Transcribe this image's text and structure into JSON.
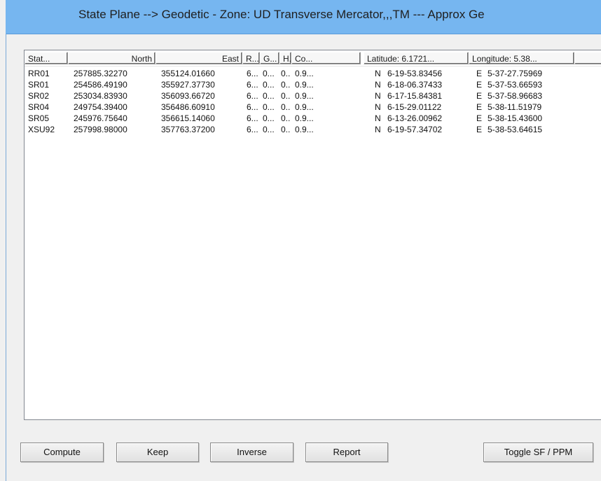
{
  "window": {
    "title": "State Plane --> Geodetic - Zone: UD Transverse Mercator,,,TM --- Approx Ge"
  },
  "columns": [
    {
      "label": "Stat..."
    },
    {
      "label": "North"
    },
    {
      "label": "East"
    },
    {
      "label": "R..."
    },
    {
      "label": "G..."
    },
    {
      "label": "H."
    },
    {
      "label": "Co..."
    },
    {
      "label": "Latitude: 6.1721..."
    },
    {
      "label": "Longitude: 5.38..."
    }
  ],
  "rows": [
    {
      "station": "RR01",
      "north": "257885.32270",
      "east": "355124.01660",
      "r": "6...",
      "g": "0...",
      "h": "0..",
      "co": "0.9...",
      "lat_hem": "N",
      "lat": "6-19-53.83456",
      "lon_hem": "E",
      "lon": "5-37-27.75969"
    },
    {
      "station": "SR01",
      "north": "254586.49190",
      "east": "355927.37730",
      "r": "6...",
      "g": "0...",
      "h": "0..",
      "co": "0.9...",
      "lat_hem": "N",
      "lat": "6-18-06.37433",
      "lon_hem": "E",
      "lon": "5-37-53.66593"
    },
    {
      "station": "SR02",
      "north": "253034.83930",
      "east": "356093.66720",
      "r": "6...",
      "g": "0...",
      "h": "0..",
      "co": "0.9...",
      "lat_hem": "N",
      "lat": "6-17-15.84381",
      "lon_hem": "E",
      "lon": "5-37-58.96683"
    },
    {
      "station": "SR04",
      "north": "249754.39400",
      "east": "356486.60910",
      "r": "6...",
      "g": "0...",
      "h": "0..",
      "co": "0.9...",
      "lat_hem": "N",
      "lat": "6-15-29.01122",
      "lon_hem": "E",
      "lon": "5-38-11.51979"
    },
    {
      "station": "SR05",
      "north": "245976.75640",
      "east": "356615.14060",
      "r": "6...",
      "g": "0...",
      "h": "0..",
      "co": "0.9...",
      "lat_hem": "N",
      "lat": "6-13-26.00962",
      "lon_hem": "E",
      "lon": "5-38-15.43600"
    },
    {
      "station": "XSU92",
      "north": "257998.98000",
      "east": "357763.37200",
      "r": "6...",
      "g": "0...",
      "h": "0..",
      "co": "0.9...",
      "lat_hem": "N",
      "lat": "6-19-57.34702",
      "lon_hem": "E",
      "lon": "5-38-53.64615"
    }
  ],
  "buttons": {
    "compute": "Compute",
    "keep": "Keep",
    "inverse": "Inverse",
    "report": "Report",
    "toggle": "Toggle SF / PPM"
  }
}
